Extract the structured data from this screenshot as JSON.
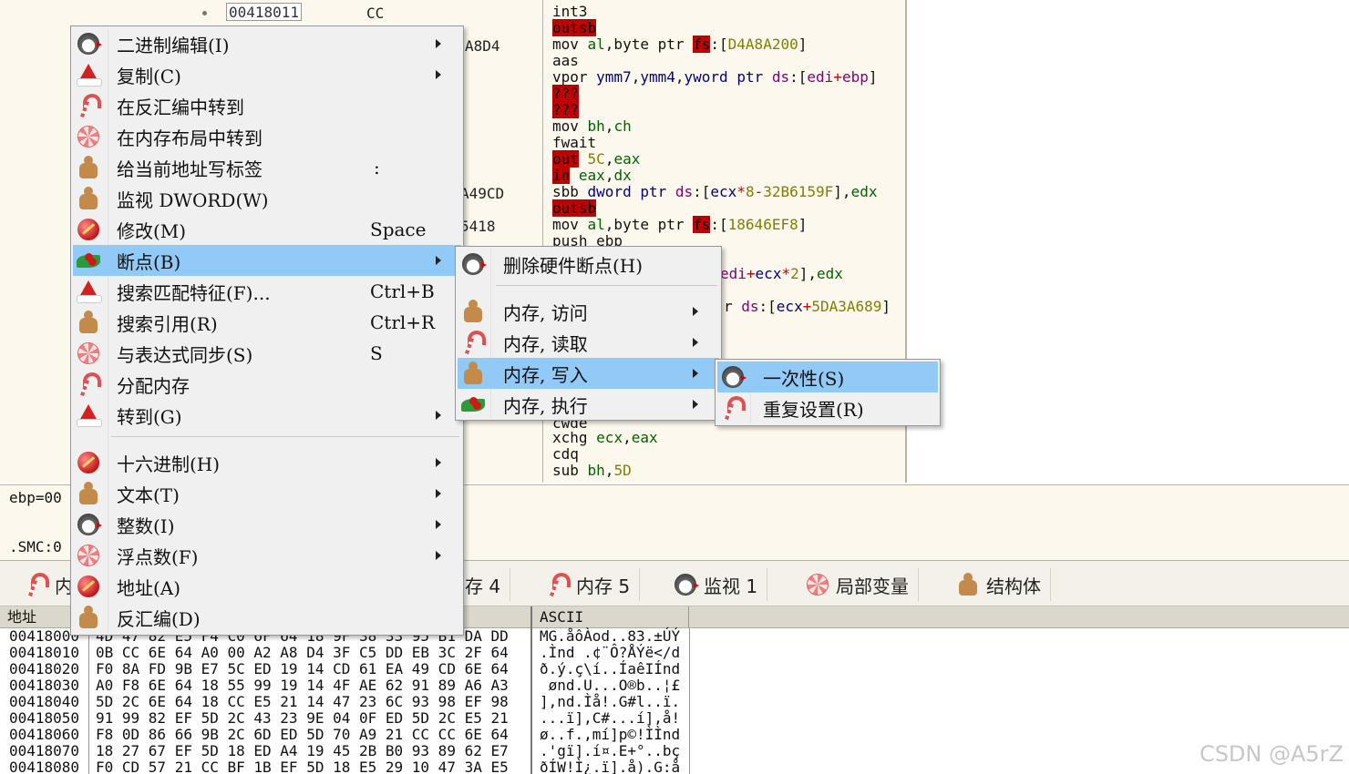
{
  "disassembly": {
    "addr_top": "00418011",
    "bytes_top": "CC",
    "fragments": [
      "A8D4",
      "A49CD",
      "5418"
    ],
    "lines": [
      {
        "text": "int3"
      },
      {
        "text": "outsb"
      },
      {
        "text": "mov al,byte ptr fs:[D4A8A200]"
      },
      {
        "text": "aas"
      },
      {
        "text": "vpor ymm7,ymm4,yword ptr ds:[edi+ebp]"
      },
      {
        "text": "???"
      },
      {
        "text": "???"
      },
      {
        "text": "mov bh,ch"
      },
      {
        "text": "fwait"
      },
      {
        "text": "out 5C,eax"
      },
      {
        "text": "in eax,dx"
      },
      {
        "text": "sbb dword ptr ds:[ecx*8-32B6159F],edx"
      },
      {
        "text": "outsb"
      },
      {
        "text": "mov al,byte ptr fs:[18646EF8]"
      },
      {
        "text": "push ebp"
      },
      {
        "text": "edi+ecx*2],edx"
      },
      {
        "text": "r ds:[ecx+5DA3A689]"
      },
      {
        "text": "cwde"
      },
      {
        "text": "xchg ecx,eax"
      },
      {
        "text": "cdq"
      },
      {
        "text": "sub bh,5D"
      }
    ]
  },
  "registers": {
    "line1": "ebp=00",
    "line2": ".SMC:0"
  },
  "tabs": [
    {
      "label": "内",
      "icon": "candy-cane-icon"
    },
    {
      "label": "存 4",
      "icon": "none"
    },
    {
      "label": "内存 5",
      "icon": "candy-cane-icon"
    },
    {
      "label": "监视 1",
      "icon": "penguin-icon"
    },
    {
      "label": "局部变量",
      "icon": "lollipop-icon"
    },
    {
      "label": "结构体",
      "icon": "gingerbread-icon"
    }
  ],
  "dump": {
    "headers": {
      "address": "地址",
      "ascii": "ASCII"
    },
    "rows": [
      {
        "addr": "00418000",
        "hex": "4D 47 82 E5 F4 C0 6F 64 18 9F 38 33 95 B1 DA DD",
        "ascii": "MG.åôÀod..83.±ÚÝ"
      },
      {
        "addr": "00418010",
        "hex": "0B CC 6E 64 A0 00 A2 A8 D4 3F C5 DD EB 3C 2F 64",
        "ascii": ".Ìnd .¢¨Ô?ÅÝë</d"
      },
      {
        "addr": "00418020",
        "hex": "F0 8A FD 9B E7 5C ED 19 14 CD 61 EA 49 CD 6E 64",
        "ascii": "ð.ý.ç\\í..ÍaêIÍnd"
      },
      {
        "addr": "00418030",
        "hex": "A0 F8 6E 64 18 55 99 19 14 4F AE 62 91 89 A6 A3",
        "ascii": " ønd.U...O®b..¦£"
      },
      {
        "addr": "00418040",
        "hex": "5D 2C 6E 64 18 CC E5 21 14 47 23 6C 93 98 EF 98",
        "ascii": "],nd.Ìå!.G#l..ï."
      },
      {
        "addr": "00418050",
        "hex": "91 99 82 EF 5D 2C 43 23 9E 04 0F ED 5D 2C E5 21",
        "ascii": "...ï],C#...í],å!"
      },
      {
        "addr": "00418060",
        "hex": "F8 0D 86 66 9B 2C 6D ED 5D 70 A9 21 CC CC 6E 64",
        "ascii": "ø..f.,mí]p©!ÌÌnd"
      },
      {
        "addr": "00418070",
        "hex": "18 27 67 EF 5D 18 ED A4 19 45 2B B0 93 89 62 E7",
        "ascii": ".'gï].í¤.E+°..bç"
      },
      {
        "addr": "00418080",
        "hex": "F0 CD 57 21 CC BF 1B EF 5D 18 E5 29 10 47 3A E5",
        "ascii": "ðÍW!Ì¿.ï].å).G:å"
      }
    ]
  },
  "watermark": "CSDN @A5rZ",
  "context_menu": {
    "items": [
      {
        "label": "二进制编辑(I)",
        "shortcut": "",
        "submenu": true,
        "icon": "penguin-icon"
      },
      {
        "label": "复制(C)",
        "shortcut": "",
        "submenu": true,
        "icon": "santa-hat-icon"
      },
      {
        "label": "在反汇编中转到",
        "shortcut": "",
        "submenu": false,
        "icon": "candy-cane-icon"
      },
      {
        "label": "在内存布局中转到",
        "shortcut": "",
        "submenu": false,
        "icon": "lollipop-icon"
      },
      {
        "label": "给当前地址写标签",
        "shortcut": ":",
        "submenu": false,
        "icon": "gingerbread-icon"
      },
      {
        "label": "监视 DWORD(W)",
        "shortcut": "",
        "submenu": false,
        "icon": "gingerbread-icon"
      },
      {
        "label": "修改(M)",
        "shortcut": "Space",
        "submenu": false,
        "icon": "ornament-icon"
      },
      {
        "label": "断点(B)",
        "shortcut": "",
        "submenu": true,
        "icon": "holly-icon"
      },
      {
        "label": "搜索匹配特征(F)...",
        "shortcut": "Ctrl+B",
        "submenu": false,
        "icon": "santa-hat-icon"
      },
      {
        "label": "搜索引用(R)",
        "shortcut": "Ctrl+R",
        "submenu": false,
        "icon": "gingerbread-icon"
      },
      {
        "label": "与表达式同步(S)",
        "shortcut": "S",
        "submenu": false,
        "icon": "lollipop-icon"
      },
      {
        "label": "分配内存",
        "shortcut": "",
        "submenu": false,
        "icon": "candy-cane-icon"
      },
      {
        "label": "转到(G)",
        "shortcut": "",
        "submenu": true,
        "icon": "santa-hat-icon"
      },
      {
        "label": "十六进制(H)",
        "shortcut": "",
        "submenu": true,
        "icon": "ornament-icon"
      },
      {
        "label": "文本(T)",
        "shortcut": "",
        "submenu": true,
        "icon": "gingerbread-icon"
      },
      {
        "label": "整数(I)",
        "shortcut": "",
        "submenu": true,
        "icon": "penguin-icon"
      },
      {
        "label": "浮点数(F)",
        "shortcut": "",
        "submenu": true,
        "icon": "lollipop-icon"
      },
      {
        "label": "地址(A)",
        "shortcut": "",
        "submenu": false,
        "icon": "ornament-icon"
      },
      {
        "label": "反汇编(D)",
        "shortcut": "",
        "submenu": false,
        "icon": "gingerbread-icon"
      }
    ]
  },
  "breakpoint_menu": {
    "items": [
      {
        "label": "删除硬件断点(H)",
        "icon": "penguin-icon"
      },
      {
        "label": "内存, 访问",
        "icon": "gingerbread-icon"
      },
      {
        "label": "内存, 读取",
        "icon": "candy-cane-icon"
      },
      {
        "label": "内存, 写入",
        "icon": "gingerbread-icon"
      },
      {
        "label": "内存, 执行",
        "icon": "holly-icon"
      }
    ]
  },
  "write_menu": {
    "items": [
      {
        "label": "一次性(S)",
        "icon": "penguin-icon"
      },
      {
        "label": "重复设置(R)",
        "icon": "candy-cane-icon"
      }
    ]
  }
}
